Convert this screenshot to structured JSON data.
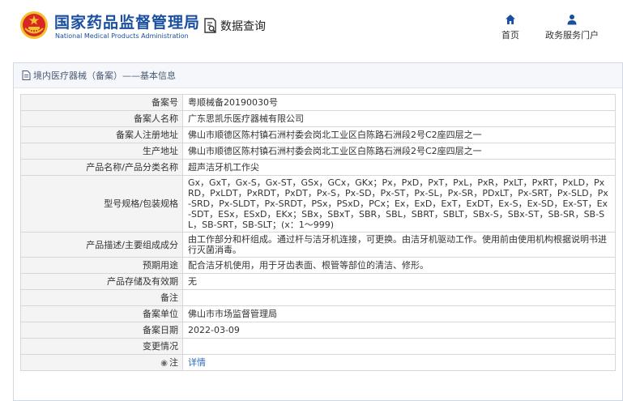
{
  "header": {
    "brand_cn": "国家药品监督管理局",
    "brand_en": "National Medical Products Administration",
    "query_label": "数据查询",
    "nav": {
      "home_label": "首页",
      "home_icon": "home-icon",
      "gov_label": "政务服务门户",
      "gov_icon": "user-icon"
    }
  },
  "panel": {
    "title": "境内医疗器械（备案）——基本信息",
    "rows": [
      {
        "key": "备案号",
        "value": "粤顺械备20190030号"
      },
      {
        "key": "备案人名称",
        "value": "广东思凯乐医疗器械有限公司"
      },
      {
        "key": "备案人注册地址",
        "value": "佛山市顺德区陈村镇石洲村委会岗北工业区白陈路石洲段2号C2座四层之一"
      },
      {
        "key": "生产地址",
        "value": "佛山市顺德区陈村镇石洲村委会岗北工业区白陈路石洲段2号C2座四层之一"
      },
      {
        "key": "产品名称/产品分类名称",
        "value": "超声洁牙机工作尖"
      },
      {
        "key": "型号规格/包装规格",
        "value": "Gx，GxT，Gx-S，Gx-ST，GSx，GCx，GKx；Px，PxD，PxT，PxL，PxR，PxLT，PxRT，PxLD，PxRD，PxLDT，PxRDT，PxDT，Px-S，Px-SD，Px-ST，Px-SL，Px-SR，PDxLT，Px-SRT，Px-SLD，Px-SRD，Px-SLDT，Px-SRDT，PSx，PSxD，PCx；Ex，ExD，ExT，ExDT，Ex-S，Ex-SD，Ex-ST，Ex-SDT，ESx，ESxD，EKx；SBx，SBxT，SBR，SBL，SBRT，SBLT，SBx-S，SBx-ST，SB-SR，SB-SL，SB-SRT，SB-SLT；(x：1～999)"
      },
      {
        "key": "产品描述/主要组成成分",
        "value": "由工作部分和杆组成。通过杆与洁牙机连接，可更换。由洁牙机驱动工作。使用前由使用机构根据说明书进行灭菌消毒。"
      },
      {
        "key": "预期用途",
        "value": "配合洁牙机使用，用于牙齿表面、根管等部位的清洁、修形。"
      },
      {
        "key": "产品存储及有效期",
        "value": "无"
      },
      {
        "key": "备注",
        "value": ""
      },
      {
        "key": "备案单位",
        "value": "佛山市市场监督管理局"
      },
      {
        "key": "备案日期",
        "value": "2022-03-09"
      },
      {
        "key": "变更情况",
        "value": ""
      },
      {
        "key": "注",
        "value": "详情",
        "icon": "location-pin-icon"
      }
    ]
  },
  "colors": {
    "brand_blue": "#1a4fa0",
    "link_blue": "#2b6cc4",
    "emblem_red": "#d8281f",
    "emblem_gold": "#f2c230"
  }
}
